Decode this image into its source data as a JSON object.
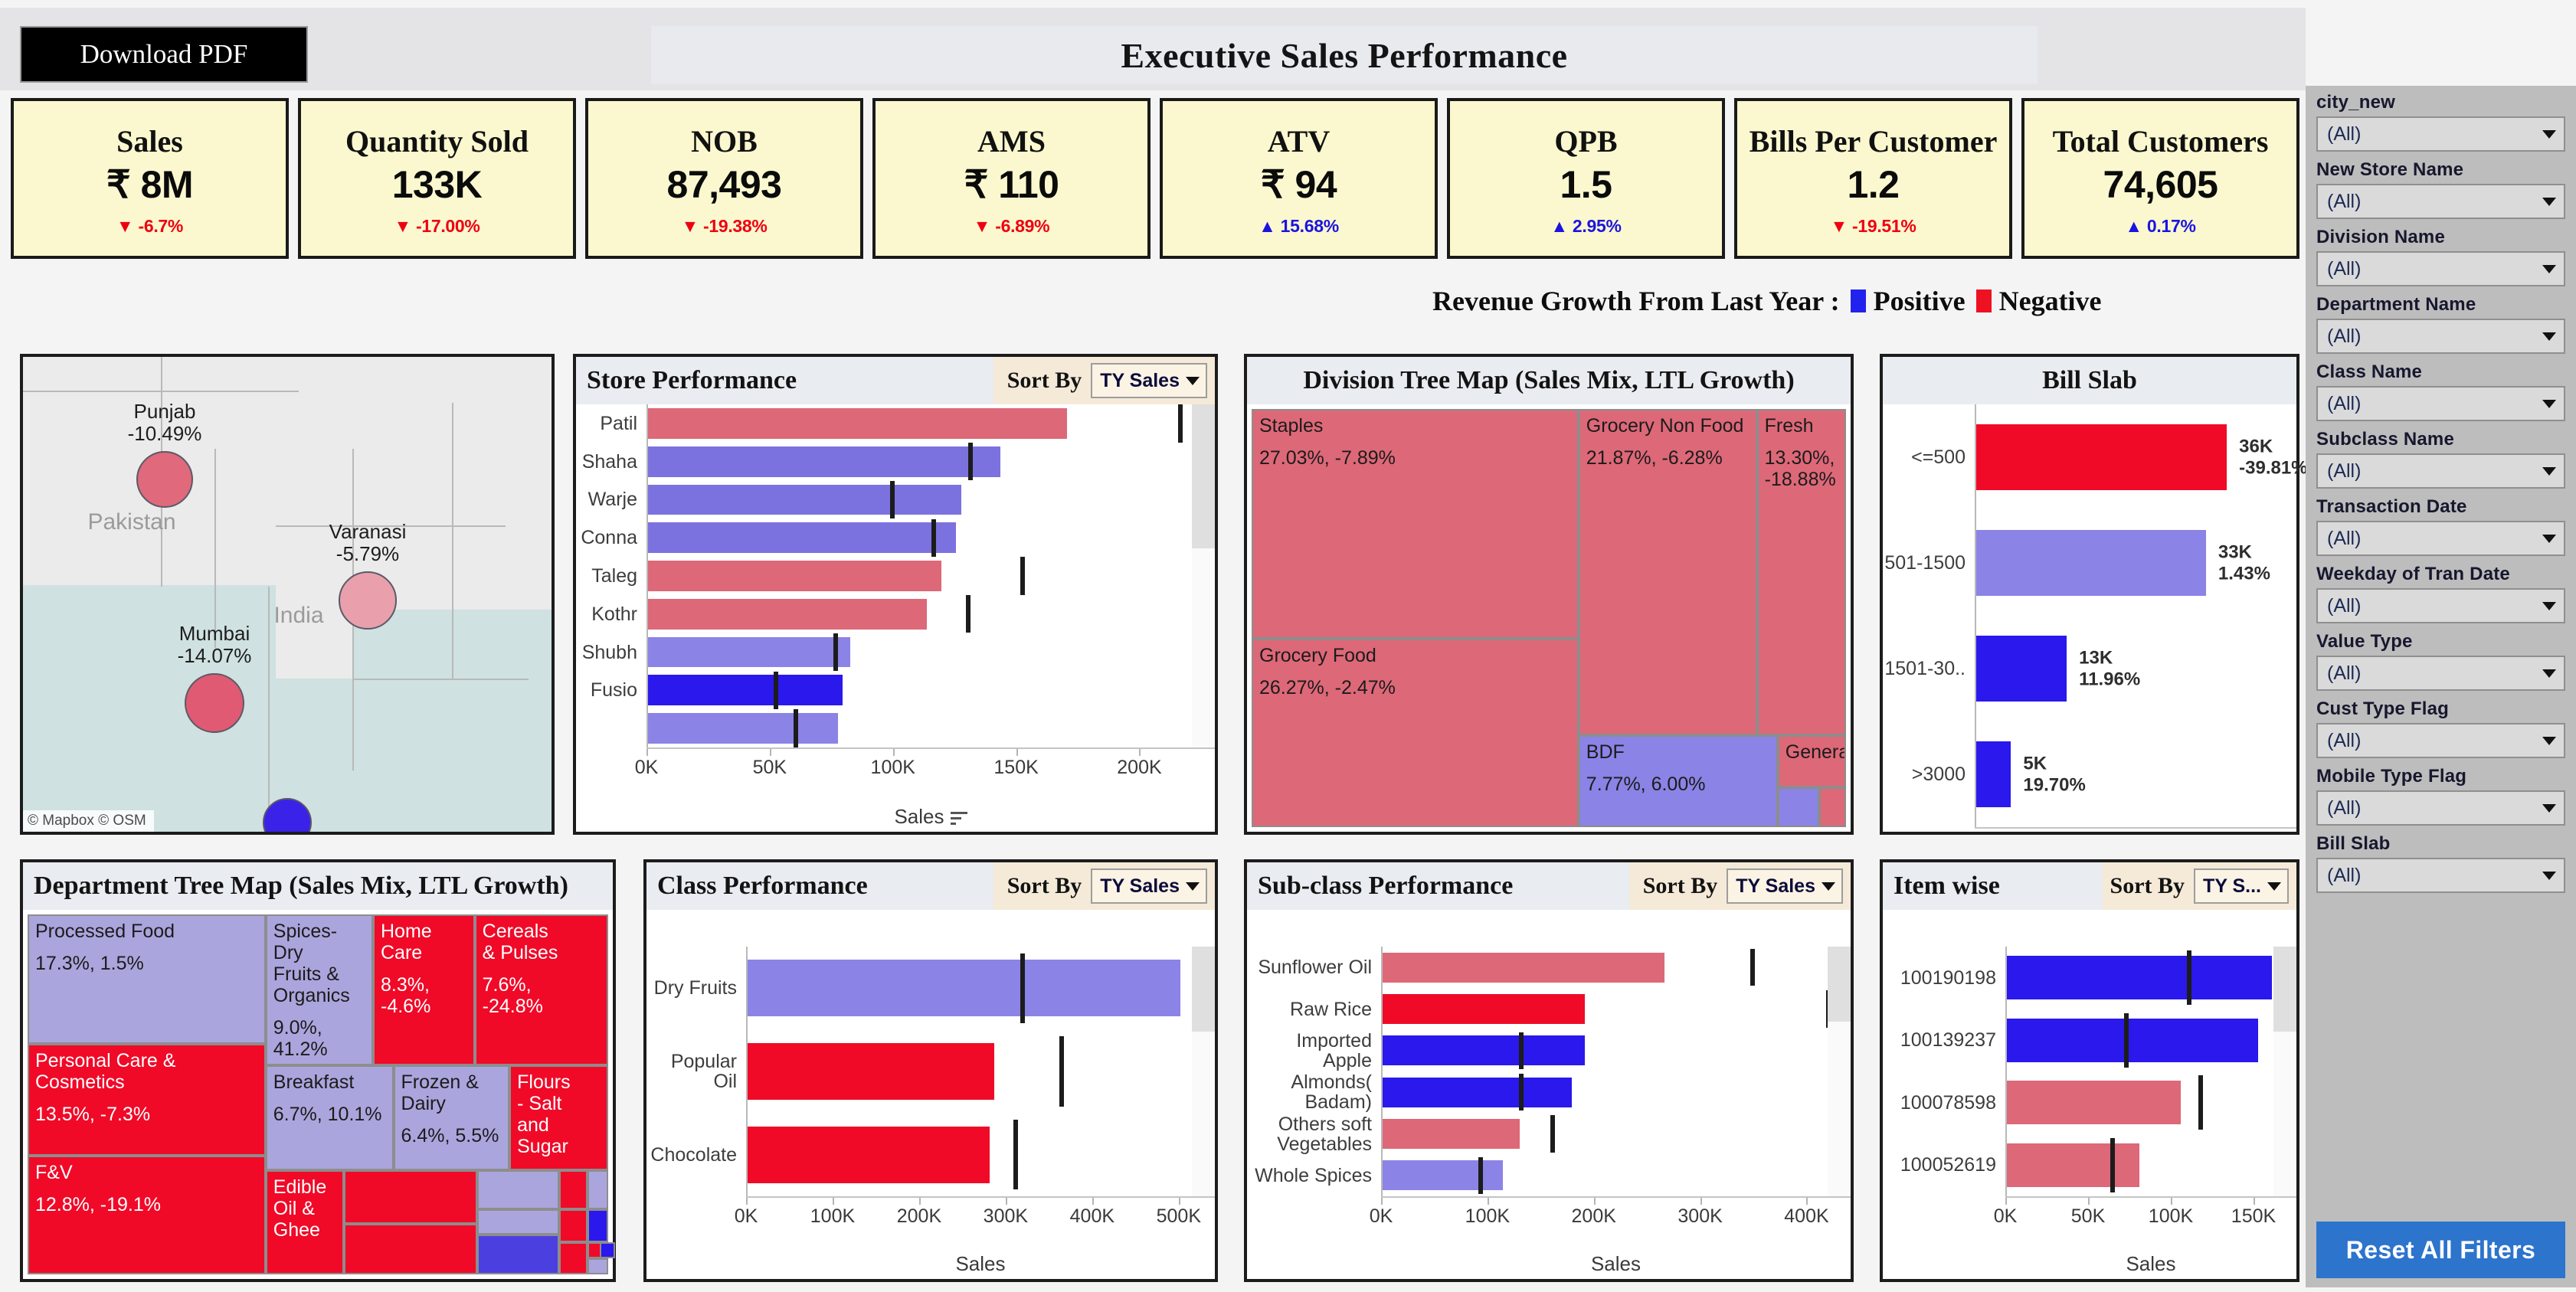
{
  "header": {
    "download_label": "Download PDF",
    "title": "Executive Sales Performance"
  },
  "kpis": [
    {
      "name": "Sales",
      "value": "₹ 8M",
      "delta": "▼ -6.7%",
      "dir": "neg"
    },
    {
      "name": "Quantity Sold",
      "value": "133K",
      "delta": "▼ -17.00%",
      "dir": "neg"
    },
    {
      "name": "NOB",
      "value": "87,493",
      "delta": "▼ -19.38%",
      "dir": "neg"
    },
    {
      "name": "AMS",
      "value": "₹ 110",
      "delta": "▼ -6.89%",
      "dir": "neg"
    },
    {
      "name": "ATV",
      "value": "₹ 94",
      "delta": "▲ 15.68%",
      "dir": "pos"
    },
    {
      "name": "QPB",
      "value": "1.5",
      "delta": "▲ 2.95%",
      "dir": "pos"
    },
    {
      "name": "Bills Per Customer",
      "value": "1.2",
      "delta": "▼ -19.51%",
      "dir": "neg"
    },
    {
      "name": "Total Customers",
      "value": "74,605",
      "delta": "▲ 0.17%",
      "dir": "pos"
    }
  ],
  "legend": {
    "caption": "Revenue Growth From Last Year :",
    "positive_label": "Positive",
    "negative_label": "Negative",
    "positive_color": "#2222ee",
    "negative_color": "#ee1122"
  },
  "map": {
    "attribution": "© Mapbox  © OSM",
    "country_labels": [
      "Pakistan",
      "India"
    ],
    "points": [
      {
        "city": "Punjab",
        "value": "-10.49%",
        "color": "#e0697c"
      },
      {
        "city": "Varanasi",
        "value": "-5.79%",
        "color": "#e9a0ac"
      },
      {
        "city": "Mumbai",
        "value": "-14.07%",
        "color": "#e05a73"
      },
      {
        "city": "",
        "value": "",
        "color": "#3b22e8"
      }
    ]
  },
  "store_performance": {
    "title": "Store Performance",
    "sort_label": "Sort By",
    "sort_value": "TY Sales"
  },
  "division_treemap": {
    "title": "Division Tree Map (Sales Mix, LTL Growth)"
  },
  "bill_slab": {
    "title": "Bill Slab"
  },
  "department_treemap": {
    "title": "Department Tree Map (Sales Mix, LTL Growth)"
  },
  "class_performance": {
    "title": "Class Performance",
    "sort_label": "Sort By",
    "sort_value": "TY Sales"
  },
  "subclass_performance": {
    "title": "Sub-class Performance",
    "sort_label": "Sort By",
    "sort_value": "TY Sales"
  },
  "item_wise": {
    "title": "Item wise",
    "sort_label": "Sort By",
    "sort_value": "TY S..."
  },
  "filters": {
    "items": [
      {
        "label": "city_new",
        "value": "(All)"
      },
      {
        "label": "New Store Name",
        "value": "(All)"
      },
      {
        "label": "Division Name",
        "value": "(All)"
      },
      {
        "label": "Department Name",
        "value": "(All)"
      },
      {
        "label": "Class Name",
        "value": "(All)"
      },
      {
        "label": "Subclass Name",
        "value": "(All)"
      },
      {
        "label": "Transaction Date",
        "value": "(All)"
      },
      {
        "label": "Weekday of Tran Date",
        "value": "(All)"
      },
      {
        "label": "Value Type",
        "value": "(All)"
      },
      {
        "label": "Cust Type Flag",
        "value": "(All)"
      },
      {
        "label": "Mobile Type Flag",
        "value": "(All)"
      },
      {
        "label": "Bill Slab",
        "value": "(All)"
      }
    ],
    "reset_label": "Reset All Filters"
  },
  "chart_data": [
    {
      "id": "store_performance",
      "type": "bar",
      "orientation": "horizontal",
      "title": "Store Performance",
      "xlabel": "Sales",
      "ylabel": "",
      "xlim": [
        0,
        230000
      ],
      "ticks": [
        0,
        50000,
        100000,
        150000,
        200000
      ],
      "tick_labels": [
        "0K",
        "50K",
        "100K",
        "150K",
        "200K"
      ],
      "categories": [
        "Patil",
        "Shaha",
        "Warje",
        "Conna",
        "Taleg",
        "Kothr",
        "Shubh",
        "Fusio",
        ""
      ],
      "values": [
        170000,
        143000,
        127000,
        125000,
        119000,
        113000,
        82000,
        79000,
        77000
      ],
      "reference_values": [
        216000,
        131000,
        99000,
        116000,
        152000,
        130000,
        76000,
        52000,
        60000
      ],
      "colors": [
        "#dd6878",
        "#7b72e0",
        "#7b72e0",
        "#7b72e0",
        "#dd6878",
        "#dd6878",
        "#8b83e6",
        "#2a18ec",
        "#8b83e6"
      ],
      "scrollable": true
    },
    {
      "id": "bill_slab",
      "type": "bar",
      "orientation": "horizontal",
      "title": "Bill Slab",
      "xlabel": "",
      "categories": [
        "<=500",
        "501-1500",
        "1501-30..",
        ">3000"
      ],
      "values": [
        36000,
        33000,
        13000,
        5000
      ],
      "value_labels": [
        "36K",
        "33K",
        "13K",
        "5K"
      ],
      "growth_labels": [
        "-39.81%",
        "1.43%",
        "11.96%",
        "19.70%"
      ],
      "colors": [
        "#f00a28",
        "#8b83e6",
        "#2a18ec",
        "#2a18ec"
      ],
      "xlim": [
        0,
        46000
      ]
    },
    {
      "id": "class_performance",
      "type": "bar",
      "orientation": "horizontal",
      "title": "Class Performance",
      "xlabel": "Sales",
      "xlim": [
        0,
        540000
      ],
      "ticks": [
        0,
        100000,
        200000,
        300000,
        400000,
        500000
      ],
      "tick_labels": [
        "0K",
        "100K",
        "200K",
        "300K",
        "400K",
        "500K"
      ],
      "categories": [
        "Dry Fruits",
        "Popular Oil",
        "Chocolate"
      ],
      "values": [
        500000,
        285000,
        280000
      ],
      "reference_values": [
        318000,
        363000,
        310000
      ],
      "colors": [
        "#8b83e6",
        "#f00a28",
        "#f00a28"
      ],
      "scrollable": true
    },
    {
      "id": "subclass_performance",
      "type": "bar",
      "orientation": "horizontal",
      "title": "Sub-class Performance",
      "xlabel": "Sales",
      "xlim": [
        0,
        440000
      ],
      "ticks": [
        0,
        100000,
        200000,
        300000,
        400000
      ],
      "tick_labels": [
        "0K",
        "100K",
        "200K",
        "300K",
        "400K"
      ],
      "categories": [
        "Sunflower Oil",
        "Raw Rice",
        "Imported Apple",
        "Almonds(\nBadam)",
        "Others soft\nVegetables",
        "Whole Spices"
      ],
      "values": [
        265000,
        190000,
        190000,
        178000,
        129000,
        113000
      ],
      "reference_values": [
        348000,
        419000,
        130000,
        130000,
        160000,
        92000
      ],
      "colors": [
        "#dd6878",
        "#f00a28",
        "#2a18ec",
        "#2a18ec",
        "#dd6878",
        "#8b83e6"
      ],
      "scrollable": true
    },
    {
      "id": "item_wise",
      "type": "bar",
      "orientation": "horizontal",
      "title": "Item wise",
      "xlabel": "Sales",
      "xlim": [
        0,
        175000
      ],
      "ticks": [
        0,
        50000,
        100000,
        150000
      ],
      "tick_labels": [
        "0K",
        "50K",
        "100K",
        "150K"
      ],
      "categories": [
        "100190198",
        "100139237",
        "100078598",
        "100052619"
      ],
      "values": [
        160000,
        152000,
        105000,
        80000
      ],
      "reference_values": [
        110000,
        72000,
        117000,
        64000
      ],
      "colors": [
        "#2a18ec",
        "#2a18ec",
        "#dd6878",
        "#dd6878"
      ],
      "scrollable": true
    },
    {
      "id": "division_treemap",
      "type": "treemap",
      "title": "Division Tree Map (Sales Mix, LTL Growth)",
      "cells": [
        {
          "name": "Staples",
          "mix": "27.03%",
          "growth": "-7.89%",
          "label": "27.03%,  -7.89%",
          "color": "#dd6878"
        },
        {
          "name": "Grocery Food",
          "mix": "26.27%",
          "growth": "-2.47%",
          "label": "26.27%,  -2.47%",
          "color": "#dd6878"
        },
        {
          "name": "Grocery Non Food",
          "mix": "21.87%",
          "growth": "-6.28%",
          "label": "21.87%,  -6.28%",
          "color": "#dd6878"
        },
        {
          "name": "Fresh",
          "mix": "13.30%",
          "growth": "-18.88%",
          "label": "13.30%,\n-18.88%",
          "color": "#dd6878"
        },
        {
          "name": "BDF",
          "mix": "7.77%",
          "growth": "6.00%",
          "label": "7.77%,  6.00%",
          "color": "#8b83e6"
        },
        {
          "name": "General",
          "mix": "",
          "growth": "",
          "label": "",
          "color": "#dd6878"
        }
      ]
    },
    {
      "id": "department_treemap",
      "type": "treemap",
      "title": "Department Tree Map (Sales Mix, LTL Growth)",
      "cells": [
        {
          "name": "Processed Food",
          "label": "17.3%, 1.5%",
          "color": "#aba5dd",
          "text": "#1b1b1b"
        },
        {
          "name": "Personal Care &\nCosmetics",
          "label": "13.5%, -7.3%",
          "color": "#f00a28",
          "text": "#ffffff"
        },
        {
          "name": "F&V",
          "label": "12.8%, -19.1%",
          "color": "#f00a28",
          "text": "#ffffff"
        },
        {
          "name": "Spices-Dry\nFruits &\nOrganics",
          "label": "9.0%, 41.2%",
          "color": "#aba5dd",
          "text": "#1b1b1b"
        },
        {
          "name": "Breakfast",
          "label": "6.7%, 10.1%",
          "color": "#aba5dd",
          "text": "#1b1b1b"
        },
        {
          "name": "Edible Oil &\nGhee",
          "label": "",
          "color": "#f00a28",
          "text": "#ffffff"
        },
        {
          "name": "Home\nCare",
          "label": "8.3%,\n-4.6%",
          "color": "#f00a28",
          "text": "#ffffff"
        },
        {
          "name": "Frozen &\nDairy",
          "label": "6.4%, 5.5%",
          "color": "#aba5dd",
          "text": "#1b1b1b"
        },
        {
          "name": "Cereals\n& Pulses",
          "label": "7.6%,\n-24.8%",
          "color": "#f00a28",
          "text": "#ffffff"
        },
        {
          "name": "Flours\n- Salt\nand\nSugar",
          "label": "",
          "color": "#f00a28",
          "text": "#ffffff"
        }
      ]
    }
  ]
}
